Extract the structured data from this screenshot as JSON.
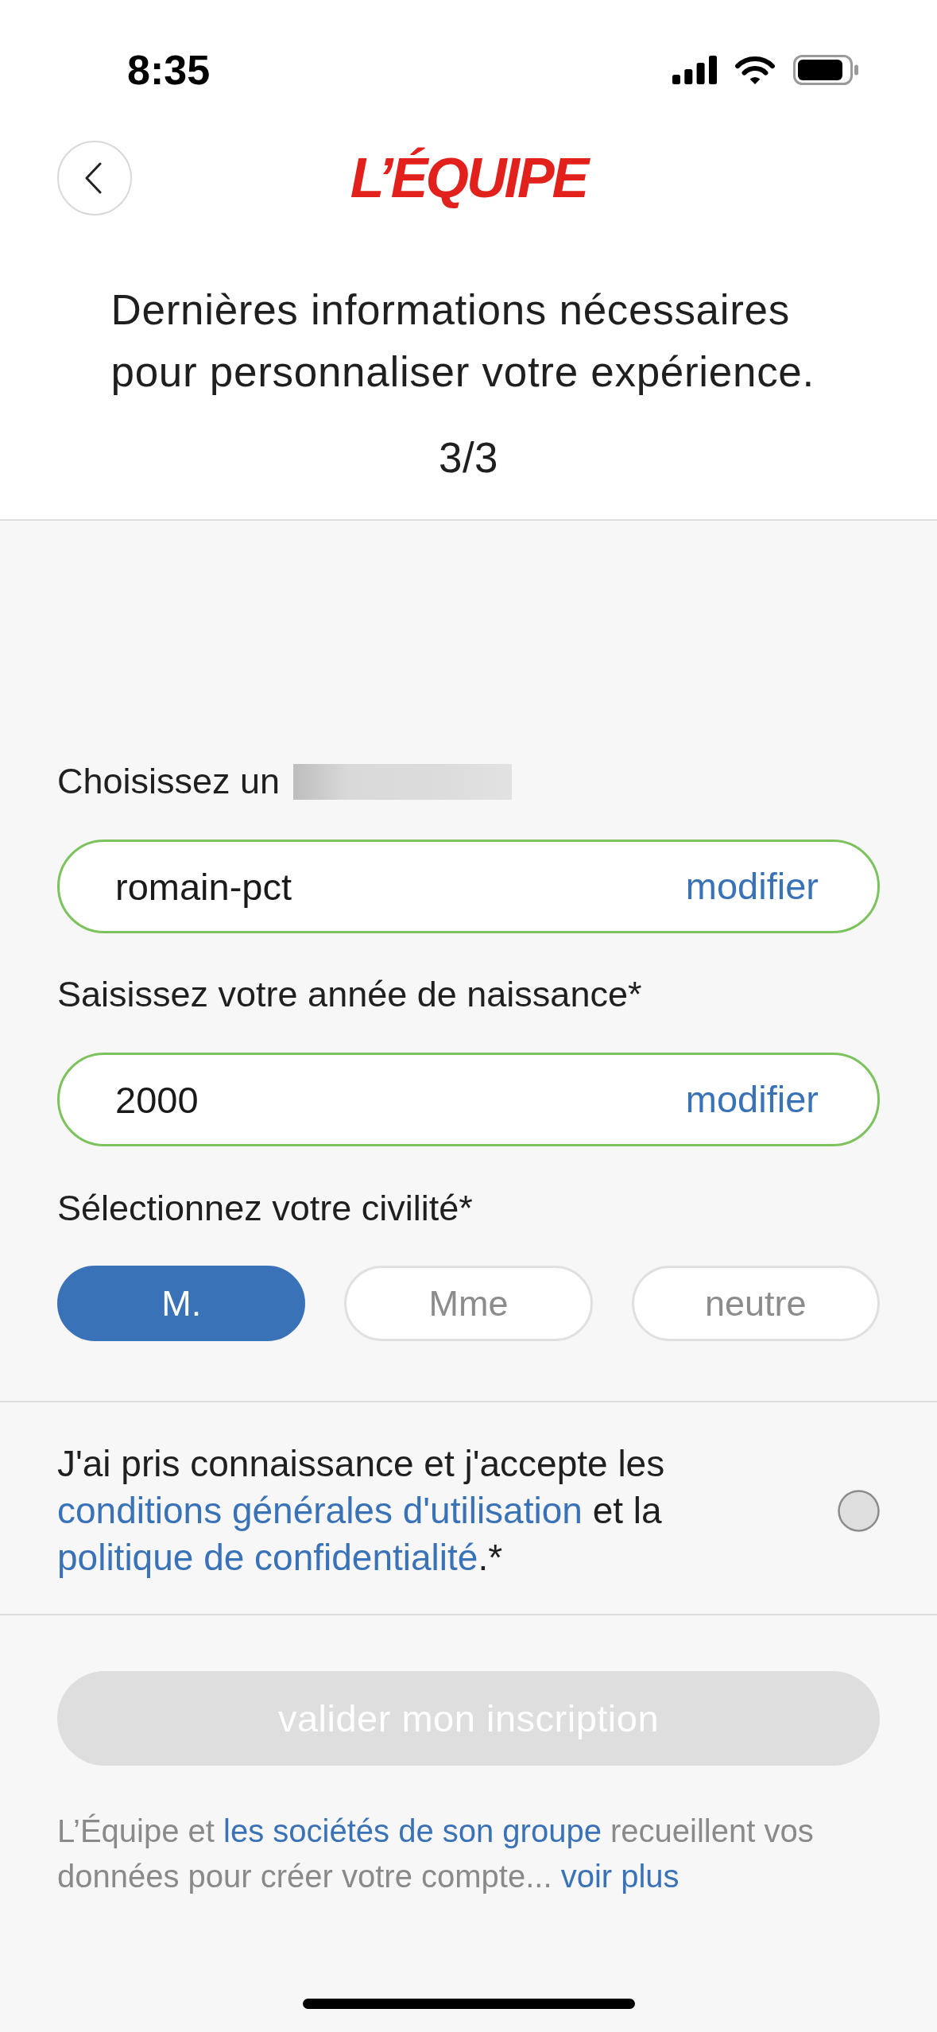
{
  "status_bar": {
    "time": "8:35"
  },
  "header": {
    "logo": "L’ÉQUIPE",
    "title": "Dernières informations nécessaires pour personnaliser votre expérience.",
    "step": "3/3"
  },
  "form": {
    "fields": [
      {
        "label": "Choisissez un",
        "redacted": true,
        "value": "romain-pct",
        "action": "modifier",
        "valid": true
      },
      {
        "label": "Saisissez votre année de naissance*",
        "redacted": false,
        "value": "2000",
        "action": "modifier",
        "valid": true
      }
    ],
    "civility": {
      "label": "Sélectionnez votre civilité*",
      "options": [
        {
          "label": "M.",
          "selected": true
        },
        {
          "label": "Mme",
          "selected": false
        },
        {
          "label": "neutre",
          "selected": false
        }
      ]
    }
  },
  "consent": {
    "parts": [
      {
        "kind": "text",
        "text": "J'ai pris connaissance et j'accepte les "
      },
      {
        "kind": "link",
        "text": "conditions générales d'utilisation"
      },
      {
        "kind": "text",
        "text": " et la "
      },
      {
        "kind": "link",
        "text": "politique de confidentialité"
      },
      {
        "kind": "text",
        "text": ".*"
      }
    ],
    "checked": false
  },
  "submit": {
    "label": "valider mon inscription",
    "disabled": true
  },
  "notice": {
    "parts": [
      {
        "kind": "text",
        "text": "L’Équipe et "
      },
      {
        "kind": "link",
        "text": "les sociétés de son groupe"
      },
      {
        "kind": "text",
        "text": " recueillent vos données pour créer votre compte... "
      },
      {
        "kind": "link",
        "text": "voir plus"
      }
    ]
  }
}
